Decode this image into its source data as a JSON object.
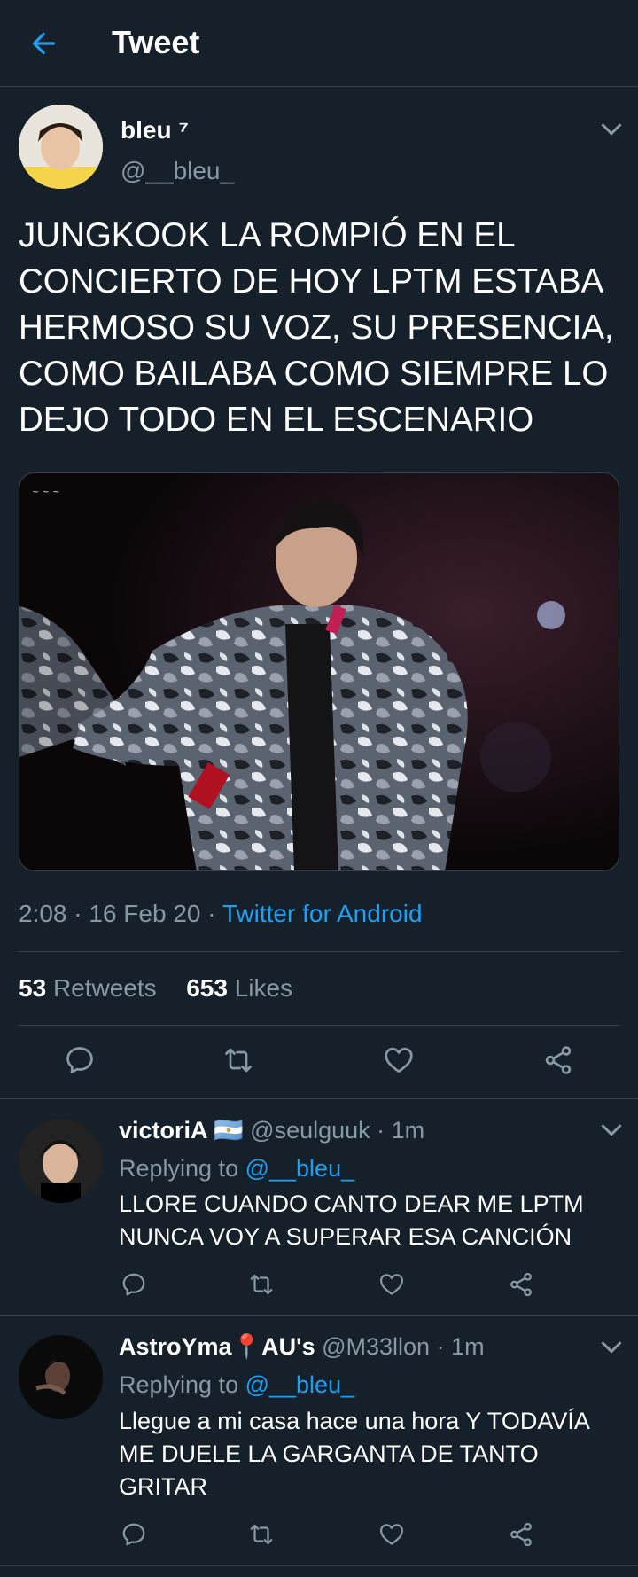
{
  "header": {
    "title": "Tweet",
    "back_icon": "arrow-left-icon"
  },
  "tweet": {
    "author_name": "bleu ⁷",
    "author_handle": "@__bleu_",
    "text": "JUNGKOOK LA ROMPIÓ EN EL CONCIERTO DE HOY LPTM ESTABA HERMOSO SU VOZ, SU PRESENCIA, COMO BAILABA COMO SIEMPRE LO DEJO TODO EN EL ESCENARIO",
    "time": "2:08 · 16 Feb 20 · ",
    "source": "Twitter for Android",
    "retweets_count": "53",
    "retweets_label": "Retweets",
    "likes_count": "653",
    "likes_label": "Likes"
  },
  "replies": [
    {
      "name": "victoriA 🇦🇷",
      "handle": "@seulguuk · 1m",
      "replying_prefix": "Replying to ",
      "replying_to": "@__bleu_",
      "text": "LLORE CUANDO CANTO DEAR ME LPTM NUNCA VOY A SUPERAR ESA CANCIÓN"
    },
    {
      "name": "AstroYma📍AU's",
      "handle": "@M33llon · 1m",
      "replying_prefix": "Replying to ",
      "replying_to": "@__bleu_",
      "text": "Llegue a mi casa hace una hora Y TODAVÍA ME DUELE LA GARGANTA DE TANTO GRITAR"
    }
  ],
  "colors": {
    "background": "#15202b",
    "accent": "#1da1f2",
    "secondary_text": "#8899a6",
    "border": "#38444d"
  },
  "icons": [
    "reply-icon",
    "retweet-icon",
    "like-icon",
    "share-icon",
    "chevron-down-icon"
  ]
}
